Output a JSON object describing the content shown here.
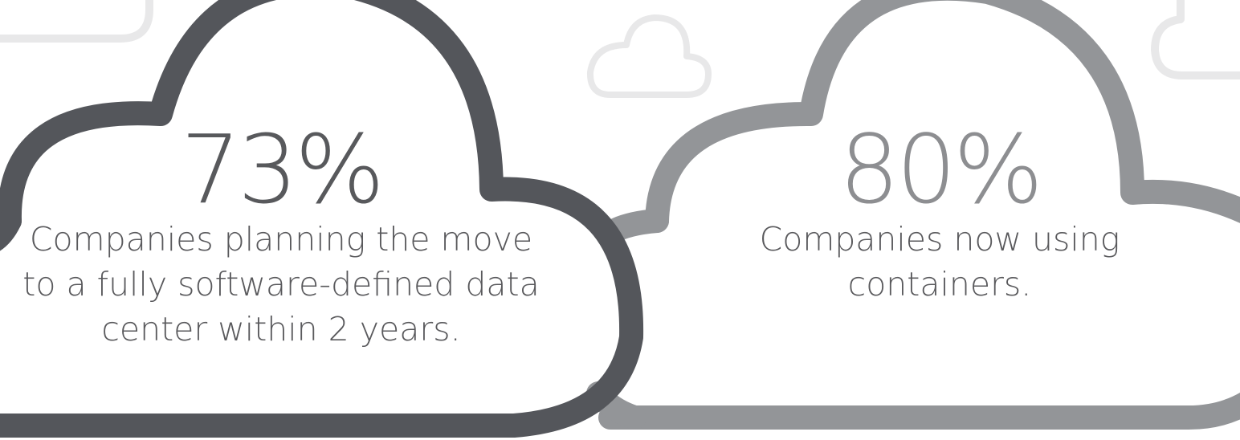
{
  "colors": {
    "dark_cloud": "#54565b",
    "light_cloud": "#939598",
    "outline_cloud": "#e8e8e9",
    "dark_text": "#58595c",
    "light_text": "#8d8e91",
    "desc_text": "#59595c"
  },
  "stats": [
    {
      "value": "73%",
      "description_lines": [
        "Companies planning the move",
        "to a fully software-defined data",
        "center within 2 years."
      ]
    },
    {
      "value": "80%",
      "description_lines": [
        "Companies now using",
        "containers."
      ]
    }
  ]
}
